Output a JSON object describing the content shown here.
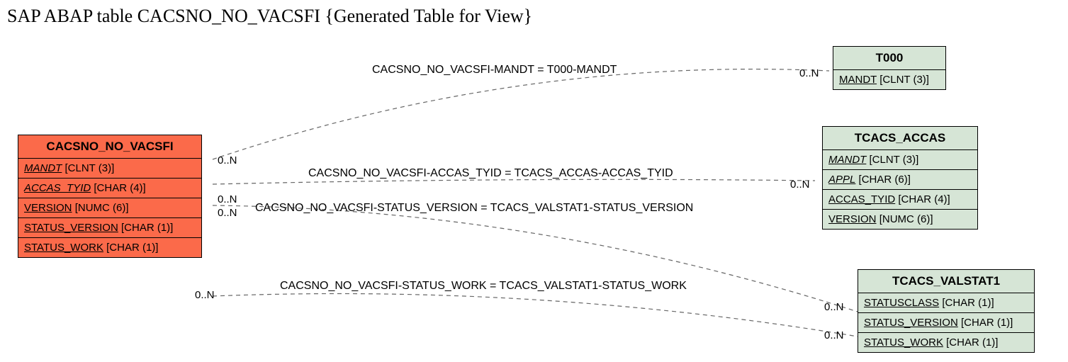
{
  "title": "SAP ABAP table CACSNO_NO_VACSFI {Generated Table for View}",
  "entities": {
    "main": {
      "name": "CACSNO_NO_VACSFI",
      "fields": [
        {
          "name": "MANDT",
          "type": "[CLNT (3)]",
          "key": true
        },
        {
          "name": "ACCAS_TYID",
          "type": "[CHAR (4)]",
          "key": true
        },
        {
          "name": "VERSION",
          "type": "[NUMC (6)]",
          "key": false
        },
        {
          "name": "STATUS_VERSION",
          "type": "[CHAR (1)]",
          "key": false
        },
        {
          "name": "STATUS_WORK",
          "type": "[CHAR (1)]",
          "key": false
        }
      ]
    },
    "t000": {
      "name": "T000",
      "fields": [
        {
          "name": "MANDT",
          "type": "[CLNT (3)]",
          "key": false
        }
      ]
    },
    "accas": {
      "name": "TCACS_ACCAS",
      "fields": [
        {
          "name": "MANDT",
          "type": "[CLNT (3)]",
          "key": true
        },
        {
          "name": "APPL",
          "type": "[CHAR (6)]",
          "key": true
        },
        {
          "name": "ACCAS_TYID",
          "type": "[CHAR (4)]",
          "key": false
        },
        {
          "name": "VERSION",
          "type": "[NUMC (6)]",
          "key": false
        }
      ]
    },
    "valstat": {
      "name": "TCACS_VALSTAT1",
      "fields": [
        {
          "name": "STATUSCLASS",
          "type": "[CHAR (1)]",
          "key": false
        },
        {
          "name": "STATUS_VERSION",
          "type": "[CHAR (1)]",
          "key": false
        },
        {
          "name": "STATUS_WORK",
          "type": "[CHAR (1)]",
          "key": false
        }
      ]
    }
  },
  "relations": {
    "r1": "CACSNO_NO_VACSFI-MANDT = T000-MANDT",
    "r2": "CACSNO_NO_VACSFI-ACCAS_TYID = TCACS_ACCAS-ACCAS_TYID",
    "r3": "CACSNO_NO_VACSFI-STATUS_VERSION = TCACS_VALSTAT1-STATUS_VERSION",
    "r4": "CACSNO_NO_VACSFI-STATUS_WORK = TCACS_VALSTAT1-STATUS_WORK"
  },
  "card": "0..N"
}
